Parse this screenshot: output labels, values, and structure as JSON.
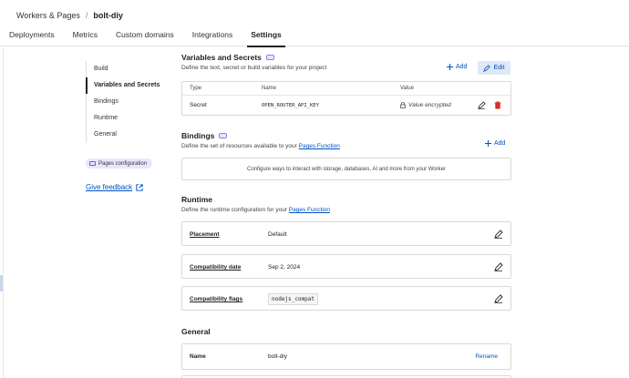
{
  "breadcrumb": {
    "parent": "Workers & Pages",
    "separator": "/",
    "current": "bolt-diy"
  },
  "tabs": [
    {
      "label": "Deployments"
    },
    {
      "label": "Metrics"
    },
    {
      "label": "Custom domains"
    },
    {
      "label": "Integrations"
    },
    {
      "label": "Settings",
      "active": true
    }
  ],
  "sidenav": {
    "items": [
      {
        "label": "Build"
      },
      {
        "label": "Variables and Secrets",
        "active": true
      },
      {
        "label": "Bindings"
      },
      {
        "label": "Runtime"
      },
      {
        "label": "General"
      }
    ],
    "pill": "Pages configuration",
    "feedback": "Give feedback"
  },
  "variables": {
    "title": "Variables and Secrets",
    "description": "Define the text, secret or build variables for your project",
    "add_label": "Add",
    "edit_label": "Edit",
    "columns": {
      "type": "Type",
      "name": "Name",
      "value": "Value"
    },
    "rows": [
      {
        "type": "Secret",
        "name": "OPEN_ROUTER_API_KEY",
        "value": "Value encrypted"
      }
    ]
  },
  "bindings": {
    "title": "Bindings",
    "description_prefix": "Define the set of resources available to your",
    "description_link": "Pages Function",
    "add_label": "Add",
    "empty_text": "Configure ways to interact with storage, databases, AI and more from your Worker"
  },
  "runtime": {
    "title": "Runtime",
    "description_prefix": "Define the runtime configuration for your",
    "description_link": "Pages Function",
    "rows": [
      {
        "label": "Placement",
        "value": "Default"
      },
      {
        "label": "Compatibility date",
        "value": "Sep 2, 2024"
      },
      {
        "label": "Compatibility flags",
        "value": "nodejs_compat"
      }
    ]
  },
  "general": {
    "title": "General",
    "name_label": "Name",
    "name_value": "bolt-diy",
    "rename_label": "Rename"
  },
  "colors": {
    "link": "#0051c3",
    "accent_purple": "#6b5be0",
    "danger": "#d92d20"
  }
}
